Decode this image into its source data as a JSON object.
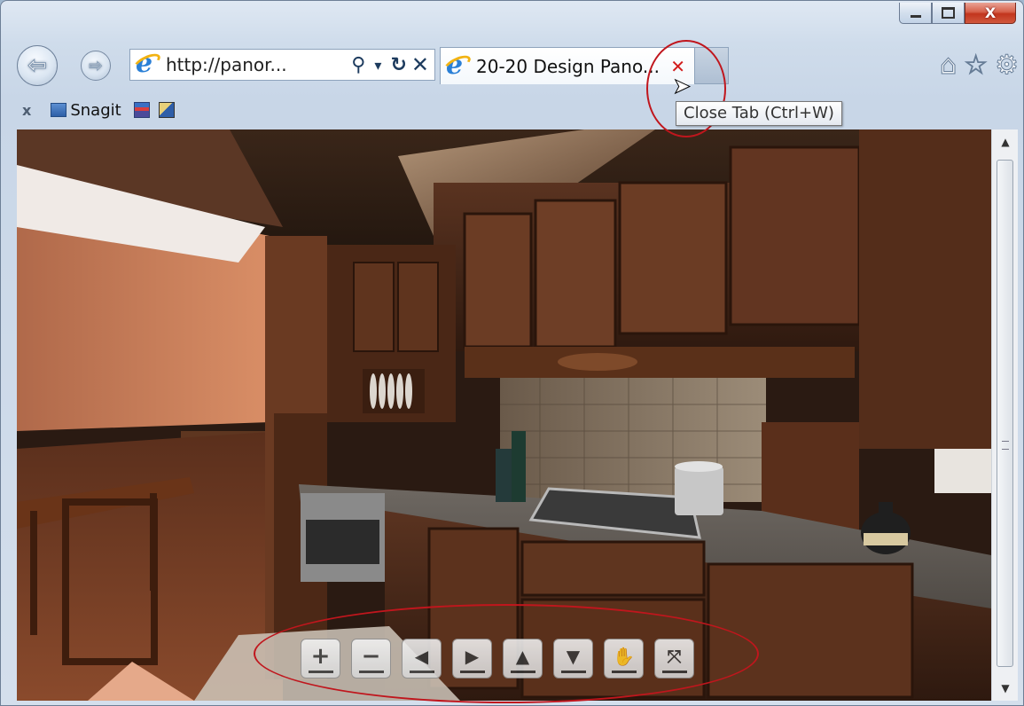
{
  "window": {
    "minimize_icon": "minimize-icon",
    "maximize_icon": "maximize-icon",
    "close_icon": "close-icon",
    "close_label": "X",
    "close_color": "#c2351d"
  },
  "nav": {
    "back_icon": "back-arrow-icon",
    "forward_icon": "forward-arrow-icon",
    "back_glyph": "⇦",
    "forward_glyph": "⇨",
    "address": "http://panor...",
    "search_glyph": "⚲",
    "dropdown_glyph": "▾",
    "refresh_glyph": "↻",
    "stop_glyph": "✕"
  },
  "tab": {
    "title": "20-20 Design Pano...",
    "close_glyph": "✕",
    "close_color": "#d21c1c"
  },
  "toolbar_right": {
    "home_glyph": "⌂",
    "favorites_glyph": "☆",
    "settings_glyph": "⚙"
  },
  "favorites_bar": {
    "close_glyph": "x",
    "snagit_label": "Snagit"
  },
  "tooltip": {
    "text": "Close Tab (Ctrl+W)"
  },
  "pano_controls": [
    {
      "name": "zoom-in-button",
      "glyph": "+"
    },
    {
      "name": "zoom-out-button",
      "glyph": "−"
    },
    {
      "name": "pan-left-button",
      "glyph": "◀"
    },
    {
      "name": "pan-right-button",
      "glyph": "▶"
    },
    {
      "name": "pan-up-button",
      "glyph": "▲"
    },
    {
      "name": "pan-down-button",
      "glyph": "▼"
    },
    {
      "name": "drag-mode-button",
      "glyph": "✋"
    },
    {
      "name": "fullscreen-button",
      "glyph": "⤧"
    }
  ],
  "scrollbar": {
    "up_glyph": "▲",
    "down_glyph": "▼"
  },
  "colors": {
    "annotation_red": "#c0161d",
    "ie_blue": "#2a7fd6"
  }
}
